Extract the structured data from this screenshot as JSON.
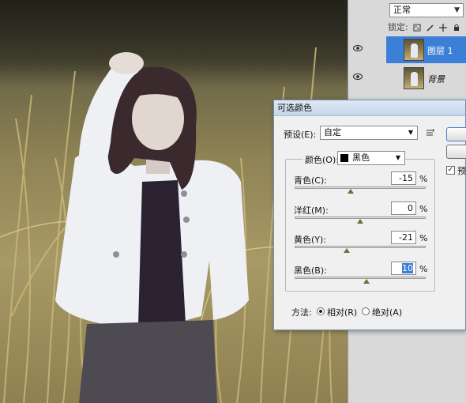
{
  "layers_panel": {
    "blend_mode": "正常",
    "lock_label": "锁定:",
    "layers": [
      {
        "name": "图层 1",
        "selected": true,
        "visible": true
      },
      {
        "name": "背景",
        "selected": false,
        "visible": true
      }
    ]
  },
  "dialog": {
    "title": "可选颜色",
    "preset_label": "预设(E):",
    "preset_value": "自定",
    "color_label": "颜色(O):",
    "color_value": "黑色",
    "sliders": [
      {
        "label": "青色(C):",
        "value": "-15",
        "unit": "%",
        "level": -15
      },
      {
        "label": "洋红(M):",
        "value": "0",
        "unit": "%",
        "level": 0
      },
      {
        "label": "黄色(Y):",
        "value": "-21",
        "unit": "%",
        "level": -21
      },
      {
        "label": "黑色(B):",
        "value": "10",
        "unit": "%",
        "level": 10
      }
    ],
    "method_label": "方法:",
    "method_options": [
      "相对(R)",
      "绝对(A)"
    ],
    "method_selected": "相对(R)",
    "preview_label": "预览",
    "preview_checked": true
  },
  "colors": {
    "selection_blue": "#3c7fd6",
    "dialog_bg": "#f0f0f0",
    "panel_bg": "#d9d9d9"
  }
}
